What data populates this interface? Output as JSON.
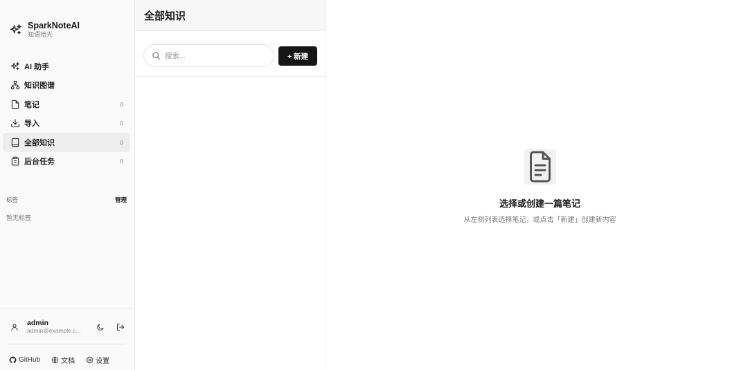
{
  "brand": {
    "name": "SparkNoteAI",
    "subtitle": "知语拾光"
  },
  "nav": [
    {
      "label": "AI 助手",
      "count": ""
    },
    {
      "label": "知识图谱",
      "count": ""
    },
    {
      "label": "笔记",
      "count": "0"
    },
    {
      "label": "导入",
      "count": "0"
    },
    {
      "label": "全部知识",
      "count": "0"
    },
    {
      "label": "后台任务",
      "count": "0"
    }
  ],
  "tags": {
    "title": "标签",
    "manage": "管理",
    "empty": "暂无标签"
  },
  "user": {
    "name": "admin",
    "email": "admin@example.c..."
  },
  "footer": {
    "github": "GitHub",
    "docs": "文档",
    "settings": "设置"
  },
  "list": {
    "title": "全部知识",
    "search_placeholder": "搜索...",
    "new_button": "+ 新建"
  },
  "empty_state": {
    "title": "选择或创建一篇笔记",
    "description": "从左侧列表选择笔记，或点击「新建」创建新内容"
  }
}
